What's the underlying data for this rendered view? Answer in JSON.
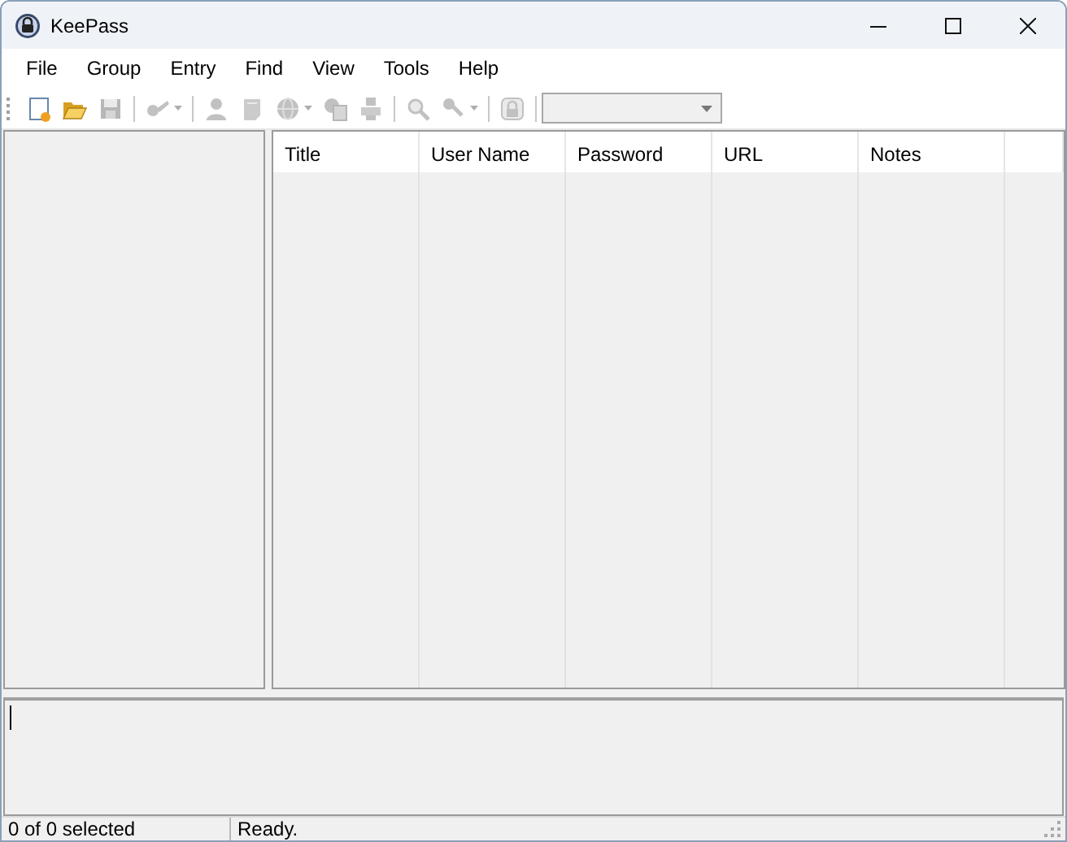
{
  "window": {
    "title": "KeePass"
  },
  "menu": [
    "File",
    "Group",
    "Entry",
    "Find",
    "View",
    "Tools",
    "Help"
  ],
  "toolbar": [
    {
      "kind": "button",
      "disabled": false
    },
    {
      "kind": "button",
      "disabled": false
    },
    {
      "kind": "button",
      "disabled": true
    },
    {
      "kind": "separator"
    },
    {
      "kind": "dropdown",
      "disabled": true
    },
    {
      "kind": "separator"
    },
    {
      "kind": "button",
      "disabled": true
    },
    {
      "kind": "button",
      "disabled": true
    },
    {
      "kind": "dropdown",
      "disabled": true
    },
    {
      "kind": "button",
      "disabled": true
    },
    {
      "kind": "button",
      "disabled": true
    },
    {
      "kind": "separator"
    },
    {
      "kind": "button",
      "disabled": true
    },
    {
      "kind": "dropdown",
      "disabled": true
    },
    {
      "kind": "separator"
    },
    {
      "kind": "button",
      "disabled": true
    },
    {
      "kind": "separator"
    },
    {
      "kind": "combo",
      "disabled": true
    }
  ],
  "table": {
    "columns": [
      "Title",
      "User Name",
      "Password",
      "URL",
      "Notes"
    ]
  },
  "status_bar": [
    "0 of 0 selected",
    "Ready."
  ]
}
